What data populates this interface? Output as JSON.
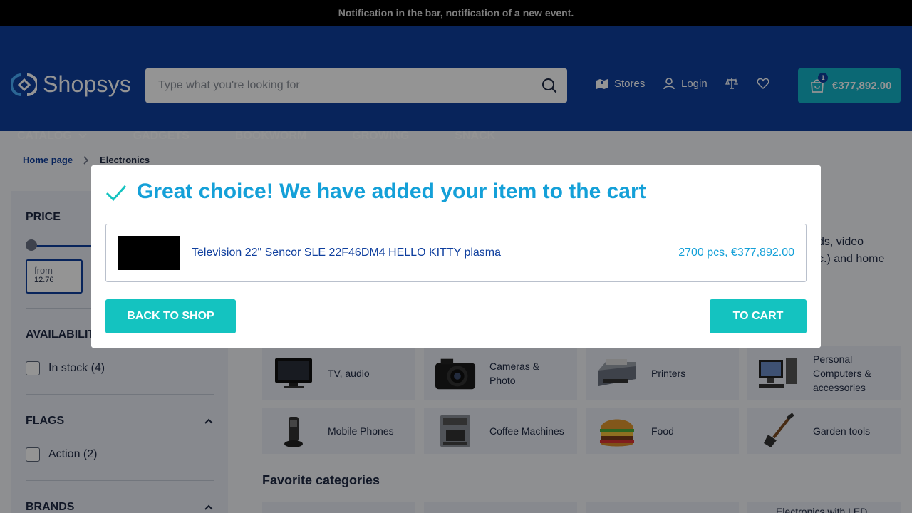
{
  "notification": "Notification in the bar, notification of a new event.",
  "header": {
    "logo_text": "Shopsys",
    "search_placeholder": "Type what you're looking for",
    "stores_label": "Stores",
    "login_label": "Login",
    "cart_count": "1",
    "cart_total": "€377,892.00"
  },
  "menu": {
    "items": [
      "CATALOG",
      "GADGETS",
      "BOOKWORM",
      "GROWING",
      "SNACK"
    ]
  },
  "breadcrumb": {
    "home": "Home page",
    "current": "Electronics"
  },
  "sidebar": {
    "price_title": "PRICE",
    "from_label": "from",
    "from_value": "12.76",
    "availability_title": "AVAILABILIT",
    "in_stock_label": "In stock (4)",
    "flags_title": "FLAGS",
    "action_label": "Action (2)",
    "brands_title": "BRANDS"
  },
  "description": {
    "line1": "ds, video",
    "line2": "c.) and home"
  },
  "categories": [
    {
      "label": "TV, audio",
      "icon": "tv-icon"
    },
    {
      "label": "Cameras & Photo",
      "icon": "camera-icon"
    },
    {
      "label": "Printers",
      "icon": "printer-icon"
    },
    {
      "label": "Personal Computers & accessories",
      "icon": "computer-icon"
    },
    {
      "label": "Mobile Phones",
      "icon": "phone-icon"
    },
    {
      "label": "Coffee Machines",
      "icon": "coffee-machine-icon"
    },
    {
      "label": "Food",
      "icon": "burger-icon"
    },
    {
      "label": "Garden tools",
      "icon": "shovel-icon"
    }
  ],
  "favorites": {
    "title": "Favorite categories",
    "items": [
      "",
      "",
      "",
      "Electronics with LED"
    ]
  },
  "modal": {
    "title": "Great choice! We have added your item to the cart",
    "product_name": "Television 22\" Sencor SLE 22F46DM4 HELLO KITTY plasma",
    "product_qty": "2700 pcs, €377,892.00",
    "back_label": "BACK TO SHOP",
    "cart_label": "TO CART"
  },
  "colors": {
    "header_bg": "#0f3f9e",
    "accent": "#14c3c0",
    "title_blue": "#14a0d8"
  }
}
